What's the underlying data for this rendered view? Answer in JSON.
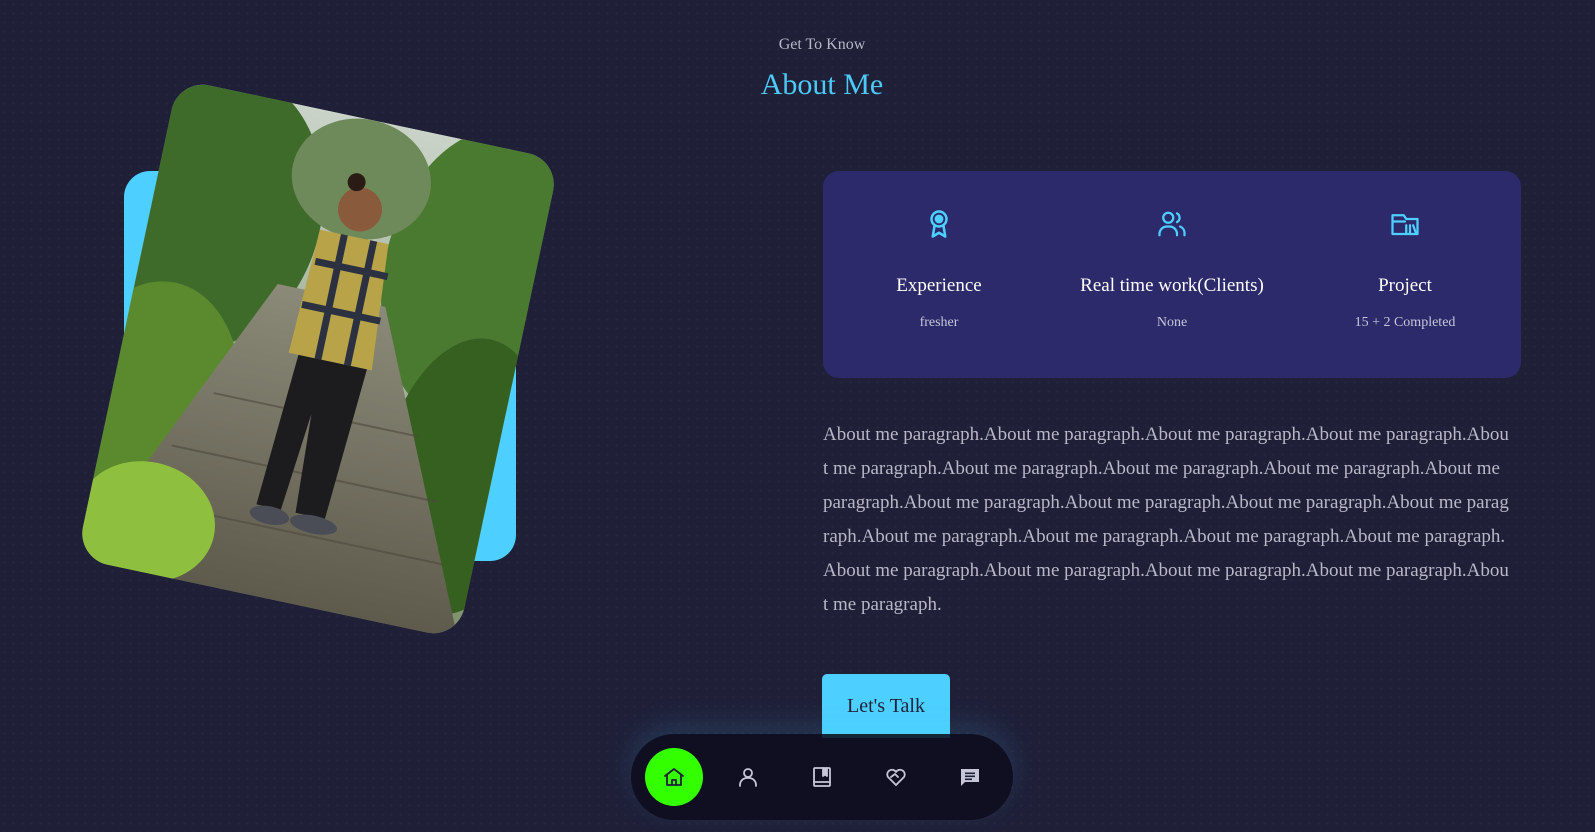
{
  "section": {
    "subtitle": "Get To Know",
    "title": "About Me"
  },
  "photo": {
    "icon": "person-portrait-photo"
  },
  "stats": [
    {
      "icon": "award-icon",
      "label": "Experience",
      "value": "fresher"
    },
    {
      "icon": "users-icon",
      "label": "Real time work(Clients)",
      "value": "None"
    },
    {
      "icon": "folder-icon",
      "label": "Project",
      "value": "15 + 2 Completed"
    }
  ],
  "about": {
    "paragraph": "About me paragraph.About me paragraph.About me paragraph.About me paragraph.About me paragraph.About me paragraph.About me paragraph.About me paragraph.About me paragraph.About me paragraph.About me paragraph.About me paragraph.About me paragraph.About me paragraph.About me paragraph.About me paragraph.About me paragraph.About me paragraph.About me paragraph.About me paragraph.About me paragraph.About me paragraph."
  },
  "cta": {
    "label": "Let's Talk"
  },
  "nav": {
    "items": [
      {
        "icon": "home-icon",
        "active": true
      },
      {
        "icon": "user-icon",
        "active": false
      },
      {
        "icon": "book-icon",
        "active": false
      },
      {
        "icon": "services-icon",
        "active": false
      },
      {
        "icon": "message-icon",
        "active": false
      }
    ]
  },
  "colors": {
    "background": "#1f1f38",
    "accent": "#4dd0ff",
    "card": "#2c2a6b",
    "nav_active": "#33ff00"
  }
}
